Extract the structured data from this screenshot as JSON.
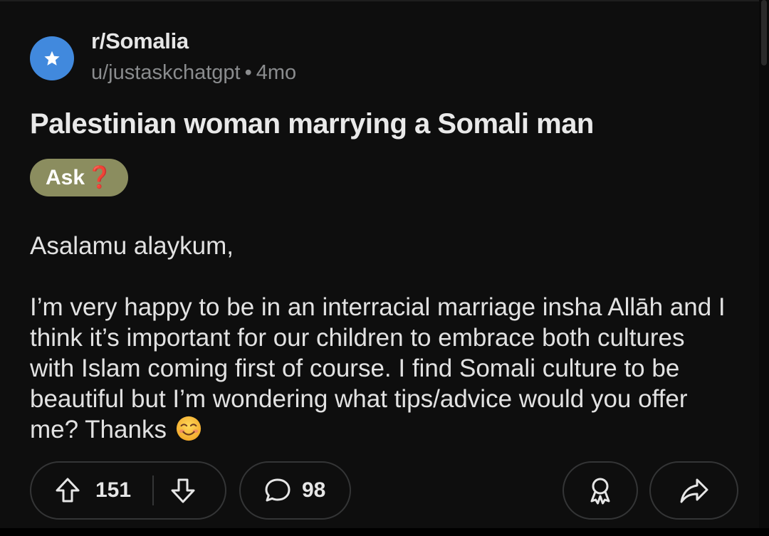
{
  "post": {
    "subreddit": "r/Somalia",
    "author": "u/justaskchatgpt",
    "separator": "•",
    "age": "4mo",
    "title": "Palestinian woman marrying a Somali man",
    "flair": {
      "label": "Ask",
      "emoji": "❓"
    },
    "body": {
      "greeting": "Asalamu alaykum,",
      "paragraph": "I’m very happy to be in an interracial marriage insha Allāh and I think it’s important for our children to embrace both cultures with Islam coming first of course. I find Somali culture to be beautiful but I’m wondering what tips/advice would you offer me? Thanks"
    }
  },
  "actions": {
    "upvotes": "151",
    "comments": "98"
  },
  "icons": {
    "avatar": "star-icon",
    "upvote": "upvote-arrow-icon",
    "downvote": "downvote-arrow-icon",
    "comment": "comment-bubble-icon",
    "award": "award-ribbon-icon",
    "share": "share-arrow-icon",
    "emoji": "smiling-face-emoji"
  },
  "colors": {
    "avatar_bg": "#4189dd",
    "flair_bg": "#8b8d5f",
    "page_bg": "#0e0e0e"
  }
}
